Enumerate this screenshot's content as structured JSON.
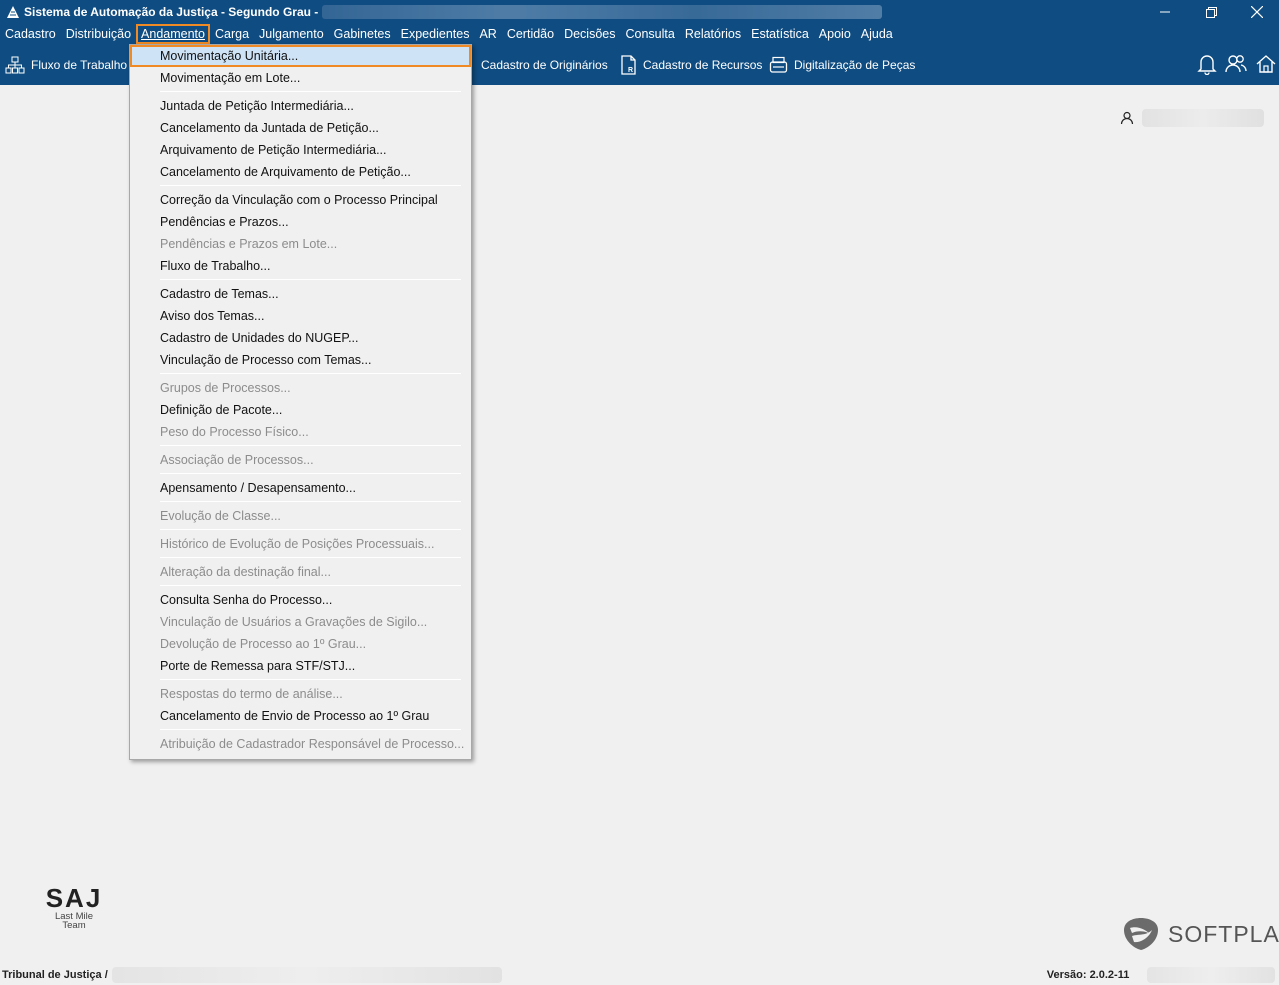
{
  "window": {
    "title": "Sistema de Automação da Justiça - Segundo Grau -",
    "controls": {
      "minimize": "—",
      "restore": "❐",
      "close": "✕"
    }
  },
  "menubar": {
    "items": [
      {
        "label": "Cadastro"
      },
      {
        "label": "Distribuição"
      },
      {
        "label": "Andamento",
        "active": true
      },
      {
        "label": "Carga"
      },
      {
        "label": "Julgamento"
      },
      {
        "label": "Gabinetes"
      },
      {
        "label": "Expedientes"
      },
      {
        "label": "AR"
      },
      {
        "label": "Certidão"
      },
      {
        "label": "Decisões"
      },
      {
        "label": "Consulta"
      },
      {
        "label": "Relatórios"
      },
      {
        "label": "Estatística"
      },
      {
        "label": "Apoio"
      },
      {
        "label": "Ajuda"
      }
    ]
  },
  "toolbar": {
    "fluxo": "Fluxo de Trabalho",
    "originarios": "Cadastro de Originários",
    "recursos": "Cadastro de Recursos",
    "digitalizacao": "Digitalização de Peças",
    "icons": [
      "sitemap-icon",
      "document-icon",
      "document-r-icon",
      "scanner-icon",
      "bell-icon",
      "users-icon",
      "home-icon"
    ]
  },
  "dropdown": {
    "items": [
      {
        "label": "Movimentação Unitária...",
        "enabled": true,
        "selected": true
      },
      {
        "label": "Movimentação em Lote...",
        "enabled": true
      },
      {
        "label": "Juntada de Petição Intermediária...",
        "enabled": true
      },
      {
        "label": "Cancelamento da Juntada de Petição...",
        "enabled": true
      },
      {
        "label": "Arquivamento de Petição Intermediária...",
        "enabled": true
      },
      {
        "label": "Cancelamento de Arquivamento de Petição...",
        "enabled": true
      },
      {
        "label": "Correção da Vinculação com o Processo Principal",
        "enabled": true
      },
      {
        "label": "Pendências e Prazos...",
        "enabled": true
      },
      {
        "label": "Pendências e Prazos em Lote...",
        "enabled": false
      },
      {
        "label": "Fluxo de Trabalho...",
        "enabled": true
      },
      {
        "label": "Cadastro de Temas...",
        "enabled": true
      },
      {
        "label": "Aviso dos Temas...",
        "enabled": true
      },
      {
        "label": "Cadastro de Unidades do NUGEP...",
        "enabled": true
      },
      {
        "label": "Vinculação de Processo com Temas...",
        "enabled": true
      },
      {
        "label": "Grupos de Processos...",
        "enabled": false
      },
      {
        "label": "Definição de Pacote...",
        "enabled": true
      },
      {
        "label": "Peso do Processo Físico...",
        "enabled": false
      },
      {
        "label": "Associação de Processos...",
        "enabled": false
      },
      {
        "label": "Apensamento / Desapensamento...",
        "enabled": true
      },
      {
        "label": "Evolução de Classe...",
        "enabled": false
      },
      {
        "label": "Histórico de Evolução de Posições Processuais...",
        "enabled": false
      },
      {
        "label": "Alteração da destinação final...",
        "enabled": false
      },
      {
        "label": "Consulta Senha do Processo...",
        "enabled": true
      },
      {
        "label": "Vinculação de Usuários a Gravações de Sigilo...",
        "enabled": false
      },
      {
        "label": "Devolução de Processo ao 1º Grau...",
        "enabled": false
      },
      {
        "label": "Porte de Remessa para STF/STJ...",
        "enabled": true
      },
      {
        "label": "Respostas do termo de análise...",
        "enabled": false
      },
      {
        "label": "Cancelamento de Envio de Processo ao 1º Grau",
        "enabled": true
      },
      {
        "label": "Atribuição de Cadastrador Responsável de Processo...",
        "enabled": false
      }
    ]
  },
  "logo": {
    "saj": "SAJ",
    "line1": "Last Mile",
    "line2": "Team",
    "softplan": "SOFTPLAN"
  },
  "status": {
    "tribunal": "Tribunal de Justiça /",
    "version": "Versão: 2.0.2-11"
  },
  "colors": {
    "brand_blue": "#0f4c81",
    "highlight_orange": "#f08a24",
    "disabled_text": "#8c8c8c"
  }
}
